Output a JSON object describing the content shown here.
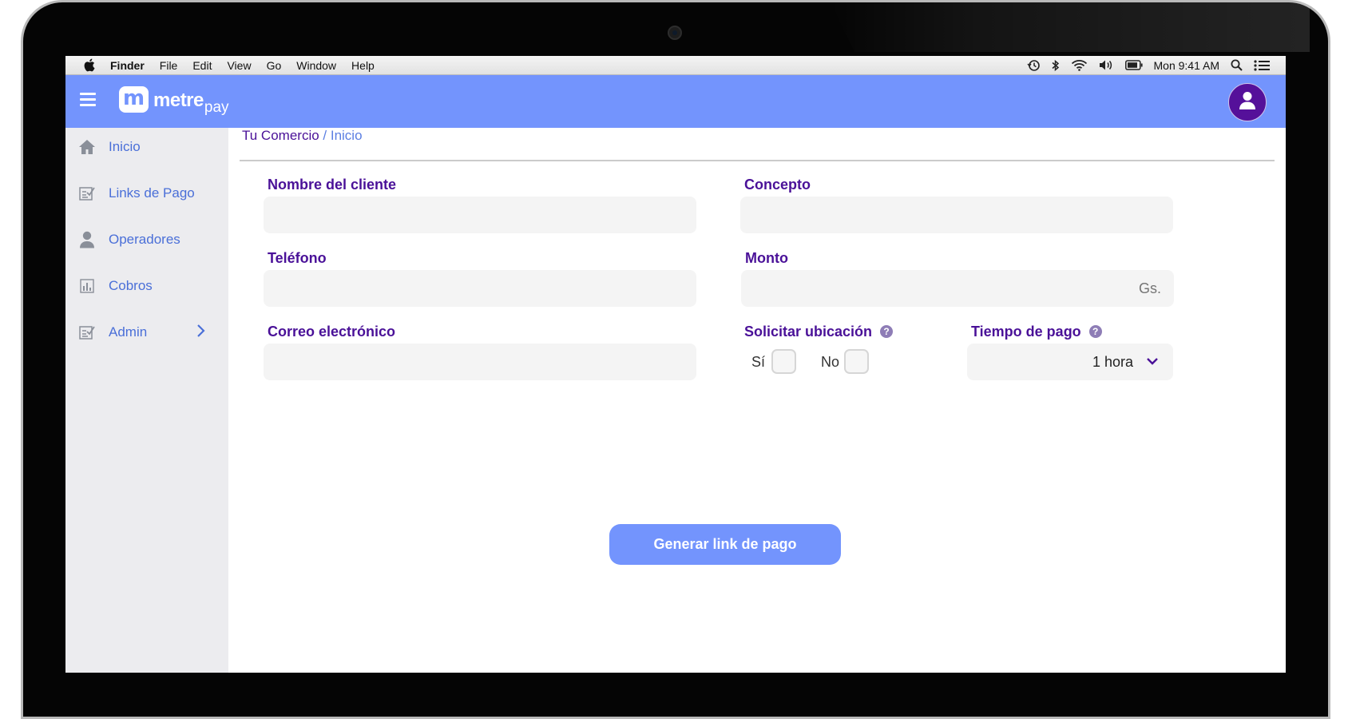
{
  "menubar": {
    "items": [
      "Finder",
      "File",
      "Edit",
      "View",
      "Go",
      "Window",
      "Help"
    ],
    "clock": "Mon 9:41 AM"
  },
  "brand": {
    "badge": "m",
    "name": "metre",
    "suffix": "pay",
    "color": "#7394fd",
    "accent": "#4a1198"
  },
  "sidebar": {
    "items": [
      {
        "label": "Inicio",
        "icon": "home-icon"
      },
      {
        "label": "Links de Pago",
        "icon": "checklist-icon"
      },
      {
        "label": "Operadores",
        "icon": "user-icon"
      },
      {
        "label": "Cobros",
        "icon": "bar-chart-icon"
      },
      {
        "label": "Admin",
        "icon": "checklist-icon",
        "has_submenu": true
      }
    ]
  },
  "breadcrumb": {
    "root": "Tu Comercio",
    "separator": " / ",
    "current": "Inicio"
  },
  "form": {
    "nombre_label": "Nombre del cliente",
    "nombre_value": "",
    "concepto_label": "Concepto",
    "concepto_value": "",
    "telefono_label": "Teléfono",
    "telefono_value": "",
    "monto_label": "Monto",
    "monto_placeholder": "Gs.",
    "correo_label": "Correo electrónico",
    "correo_value": "",
    "ubicacion_label": "Solicitar ubicación",
    "help_glyph": "?",
    "si_label": "Sí",
    "si_checked": false,
    "no_label": "No",
    "no_checked": false,
    "tiempo_label": "Tiempo de pago",
    "tiempo_value": "1 hora",
    "submit_label": "Generar link de pago"
  }
}
